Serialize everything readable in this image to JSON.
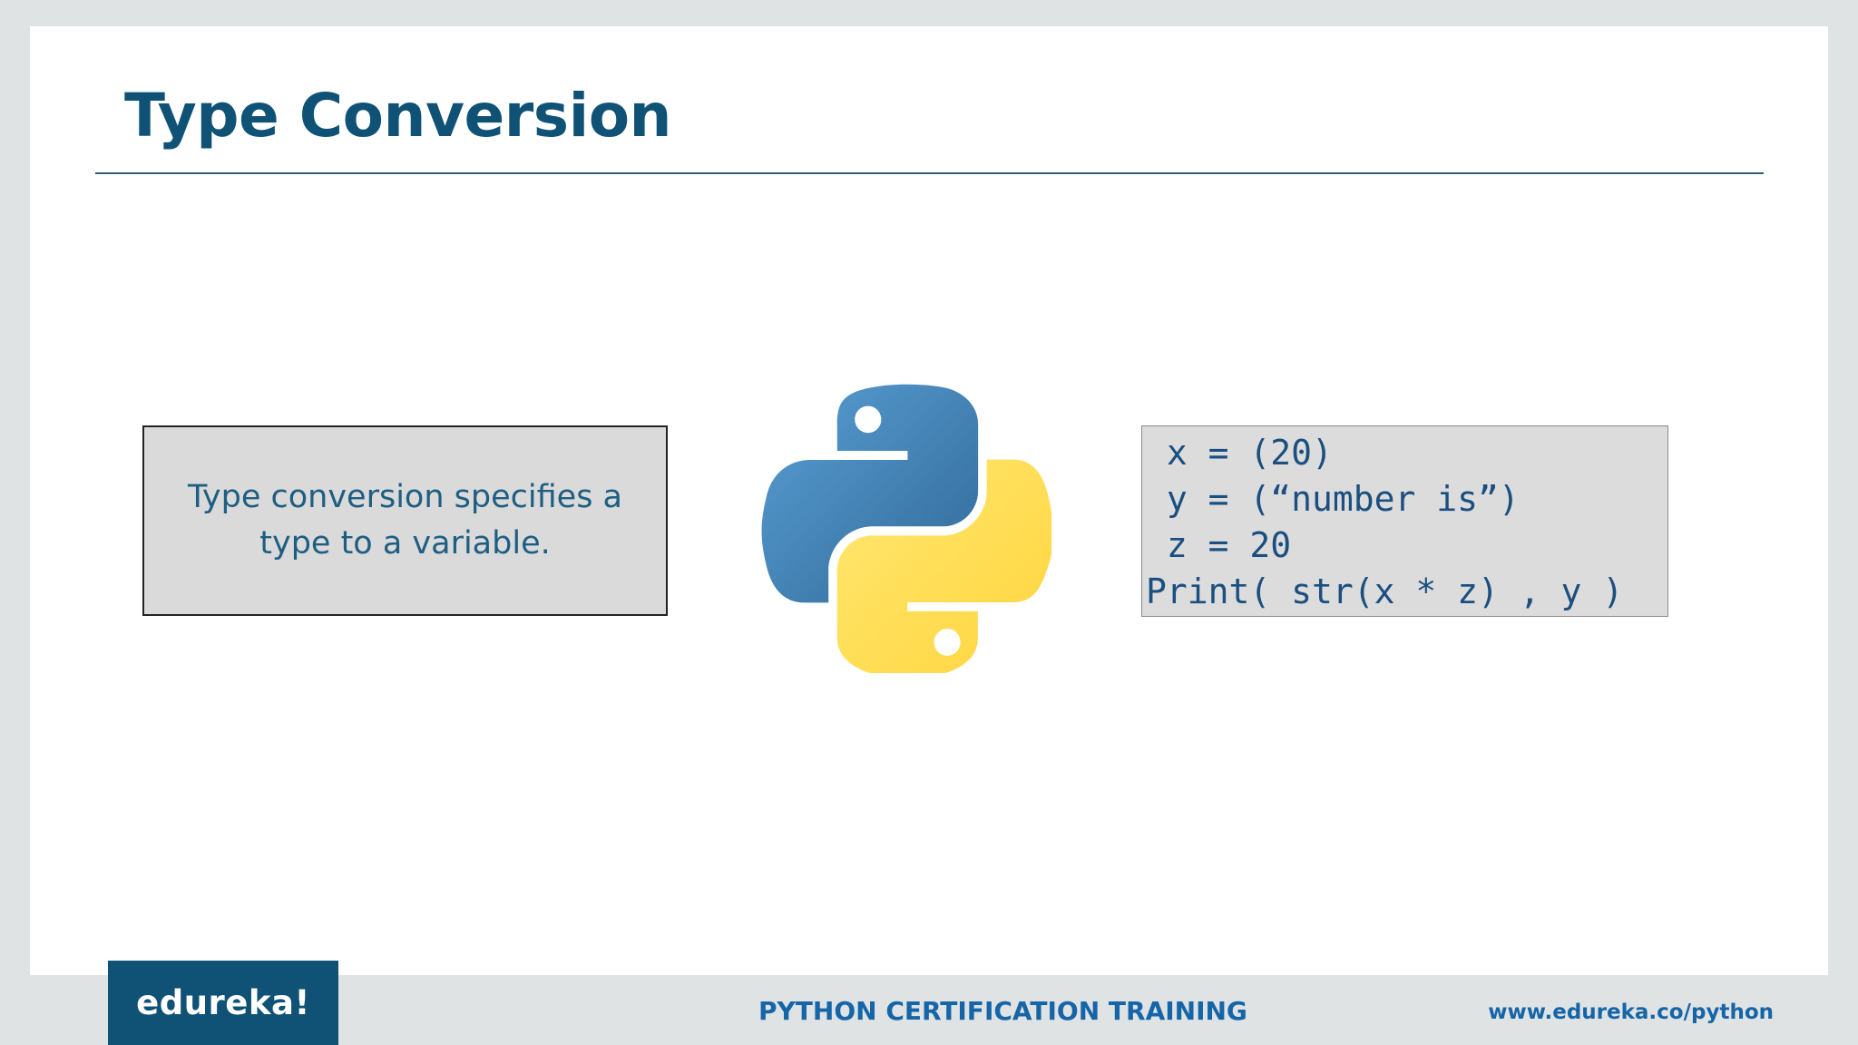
{
  "slide": {
    "title": "Type Conversion",
    "definition": "Type conversion specifies a type to a variable.",
    "code_lines": [
      " x = (20)",
      " y = (“number is”)",
      " z = 20",
      "Print( str(x * z) , y )"
    ]
  },
  "footer": {
    "brand": "edureka!",
    "course": "PYTHON CERTIFICATION TRAINING",
    "url": "www.edureka.co/python"
  },
  "colors": {
    "title": "#0f5276",
    "text_blue": "#1e5e83",
    "footer_blue": "#1565a8",
    "python_blue": "#3a70a8",
    "python_yellow": "#ffd43b"
  },
  "icons": {
    "logo": "python-logo-icon"
  }
}
